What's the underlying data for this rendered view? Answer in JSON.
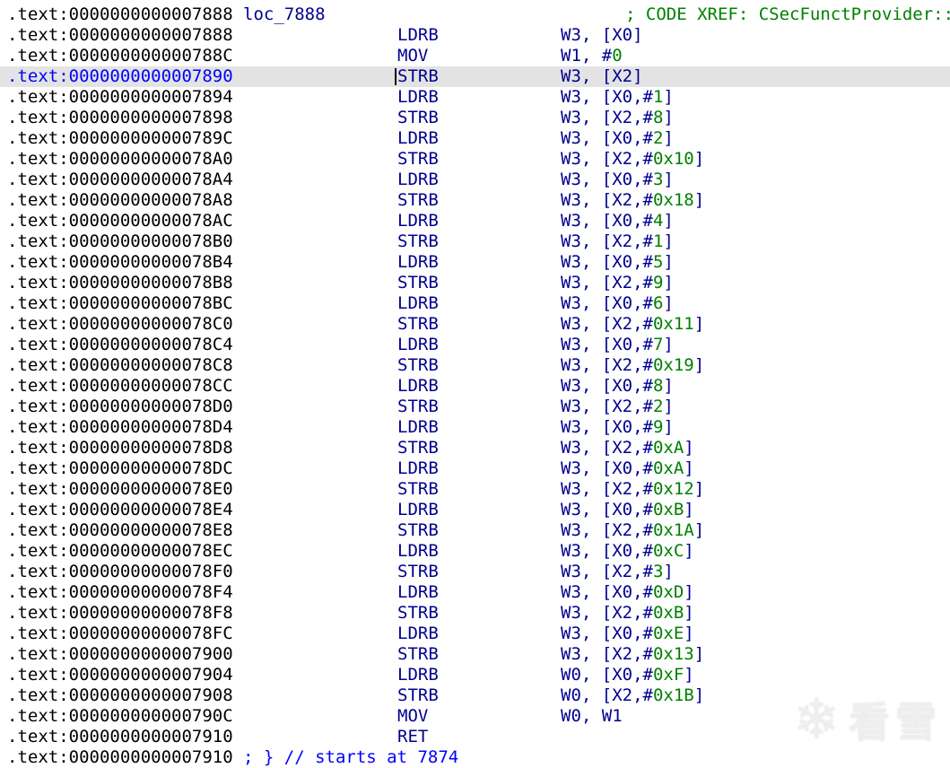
{
  "colors": {
    "address": "#000000",
    "code": "#000090",
    "immediate": "#008000",
    "comment": "#008000",
    "end_comment": "#0000ff",
    "highlight_bg": "#e3e3e3",
    "highlight_address": "#0000ff"
  },
  "watermark": {
    "text": "看雪",
    "icon_char": "❄"
  },
  "listing": {
    "rows": [
      {
        "address": ".text:0000000000007888",
        "label": "loc_7888",
        "comment": "; CODE XREF: CSecFunctProvider::"
      },
      {
        "address": ".text:0000000000007888",
        "mnemonic": "LDRB",
        "operands": "W3, [X0]"
      },
      {
        "address": ".text:000000000000788C",
        "mnemonic": "MOV",
        "operands": "W1, #0"
      },
      {
        "address": ".text:0000000000007890",
        "mnemonic": "STRB",
        "operands": "W3, [X2]",
        "highlighted": true,
        "cursor": true
      },
      {
        "address": ".text:0000000000007894",
        "mnemonic": "LDRB",
        "operands": "W3, [X0,#1]"
      },
      {
        "address": ".text:0000000000007898",
        "mnemonic": "STRB",
        "operands": "W3, [X2,#8]"
      },
      {
        "address": ".text:000000000000789C",
        "mnemonic": "LDRB",
        "operands": "W3, [X0,#2]"
      },
      {
        "address": ".text:00000000000078A0",
        "mnemonic": "STRB",
        "operands": "W3, [X2,#0x10]"
      },
      {
        "address": ".text:00000000000078A4",
        "mnemonic": "LDRB",
        "operands": "W3, [X0,#3]"
      },
      {
        "address": ".text:00000000000078A8",
        "mnemonic": "STRB",
        "operands": "W3, [X2,#0x18]"
      },
      {
        "address": ".text:00000000000078AC",
        "mnemonic": "LDRB",
        "operands": "W3, [X0,#4]"
      },
      {
        "address": ".text:00000000000078B0",
        "mnemonic": "STRB",
        "operands": "W3, [X2,#1]"
      },
      {
        "address": ".text:00000000000078B4",
        "mnemonic": "LDRB",
        "operands": "W3, [X0,#5]"
      },
      {
        "address": ".text:00000000000078B8",
        "mnemonic": "STRB",
        "operands": "W3, [X2,#9]"
      },
      {
        "address": ".text:00000000000078BC",
        "mnemonic": "LDRB",
        "operands": "W3, [X0,#6]"
      },
      {
        "address": ".text:00000000000078C0",
        "mnemonic": "STRB",
        "operands": "W3, [X2,#0x11]"
      },
      {
        "address": ".text:00000000000078C4",
        "mnemonic": "LDRB",
        "operands": "W3, [X0,#7]"
      },
      {
        "address": ".text:00000000000078C8",
        "mnemonic": "STRB",
        "operands": "W3, [X2,#0x19]"
      },
      {
        "address": ".text:00000000000078CC",
        "mnemonic": "LDRB",
        "operands": "W3, [X0,#8]"
      },
      {
        "address": ".text:00000000000078D0",
        "mnemonic": "STRB",
        "operands": "W3, [X2,#2]"
      },
      {
        "address": ".text:00000000000078D4",
        "mnemonic": "LDRB",
        "operands": "W3, [X0,#9]"
      },
      {
        "address": ".text:00000000000078D8",
        "mnemonic": "STRB",
        "operands": "W3, [X2,#0xA]"
      },
      {
        "address": ".text:00000000000078DC",
        "mnemonic": "LDRB",
        "operands": "W3, [X0,#0xA]"
      },
      {
        "address": ".text:00000000000078E0",
        "mnemonic": "STRB",
        "operands": "W3, [X2,#0x12]"
      },
      {
        "address": ".text:00000000000078E4",
        "mnemonic": "LDRB",
        "operands": "W3, [X0,#0xB]"
      },
      {
        "address": ".text:00000000000078E8",
        "mnemonic": "STRB",
        "operands": "W3, [X2,#0x1A]"
      },
      {
        "address": ".text:00000000000078EC",
        "mnemonic": "LDRB",
        "operands": "W3, [X0,#0xC]"
      },
      {
        "address": ".text:00000000000078F0",
        "mnemonic": "STRB",
        "operands": "W3, [X2,#3]"
      },
      {
        "address": ".text:00000000000078F4",
        "mnemonic": "LDRB",
        "operands": "W3, [X0,#0xD]"
      },
      {
        "address": ".text:00000000000078F8",
        "mnemonic": "STRB",
        "operands": "W3, [X2,#0xB]"
      },
      {
        "address": ".text:00000000000078FC",
        "mnemonic": "LDRB",
        "operands": "W3, [X0,#0xE]"
      },
      {
        "address": ".text:0000000000007900",
        "mnemonic": "STRB",
        "operands": "W3, [X2,#0x13]"
      },
      {
        "address": ".text:0000000000007904",
        "mnemonic": "LDRB",
        "operands": "W0, [X0,#0xF]"
      },
      {
        "address": ".text:0000000000007908",
        "mnemonic": "STRB",
        "operands": "W0, [X2,#0x1B]"
      },
      {
        "address": ".text:000000000000790C",
        "mnemonic": "MOV",
        "operands": "W0, W1"
      },
      {
        "address": ".text:0000000000007910",
        "mnemonic": "RET"
      },
      {
        "address": ".text:0000000000007910",
        "end_comment": "; } // starts at 7874"
      }
    ]
  }
}
